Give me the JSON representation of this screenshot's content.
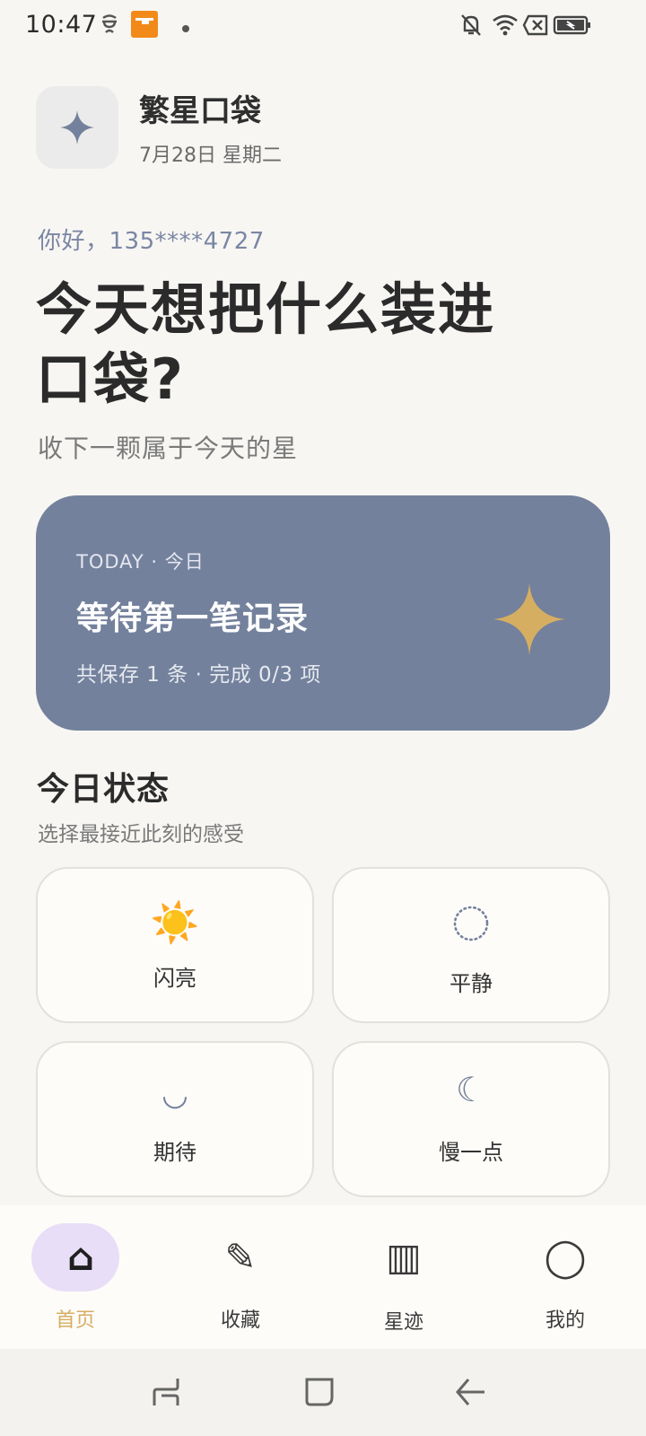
{
  "status_bar": {
    "time": "10:47"
  },
  "header": {
    "app_name": "繁星口袋",
    "date": "7月28日 星期二",
    "icon": "sparkle-star-icon"
  },
  "main": {
    "greeting": "你好，135****4727",
    "headline": "今天想把什么装进口袋?",
    "subtitle": "收下一颗属于今天的星"
  },
  "today_card": {
    "label": "TODAY · 今日",
    "title": "等待第一笔记录",
    "meta": "共保存 1 条 · 完成 0/3 项",
    "background": "#73819c",
    "star_color": "#d6ae62"
  },
  "mood_section": {
    "title": "今日状态",
    "subtitle": "选择最接近此刻的感受",
    "options": [
      {
        "label": "闪亮",
        "icon": "☀️"
      },
      {
        "label": "平静",
        "icon": "dotted-circle-icon"
      },
      {
        "label": "期待",
        "icon": "◡"
      },
      {
        "label": "慢一点",
        "icon": "☾"
      }
    ]
  },
  "bottom_nav": {
    "items": [
      {
        "label": "首页",
        "icon": "⌂",
        "active": true
      },
      {
        "label": "收藏",
        "icon": "✎"
      },
      {
        "label": "星迹",
        "icon": "▥"
      },
      {
        "label": "我的",
        "icon": "◯"
      }
    ],
    "active_color": "#d6ae62"
  }
}
